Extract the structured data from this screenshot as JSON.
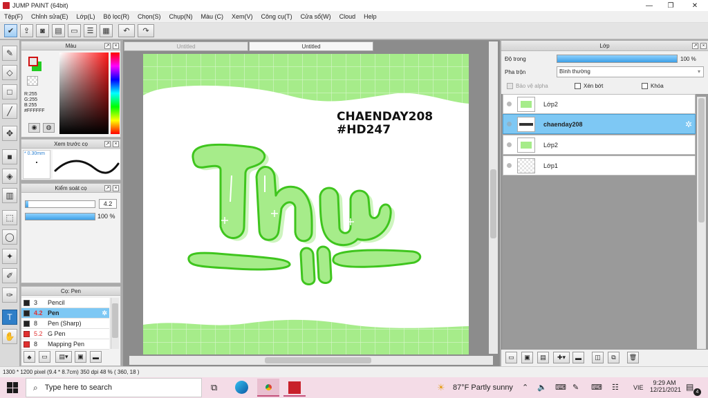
{
  "window": {
    "title": "JUMP PAINT (64bit)",
    "minimize": "—",
    "maximize": "❐",
    "close": "✕"
  },
  "menu": [
    "Tệp(F)",
    "Chỉnh sửa(E)",
    "Lớp(L)",
    "Bộ lọc(R)",
    "Chọn(S)",
    "Chụp(N)",
    "Màu (C)",
    "Xem(V)",
    "Công cụ(T)",
    "Cửa sổ(W)",
    "Cloud",
    "Help"
  ],
  "color_panel": {
    "title": "Màu",
    "r": "R:255",
    "g": "G:255",
    "b": "B:255",
    "hex": "#FFFFFF",
    "fg": "#e8e8e8",
    "bg": "#22cc22"
  },
  "brush_preview": {
    "title": "Xem trước cọ",
    "size": "0.30mm"
  },
  "brush_control": {
    "title": "Kiểm soát cọ",
    "size_value": "4.2",
    "opacity_value": "100 %",
    "size_fraction": 0.04,
    "opacity_fraction": 1.0
  },
  "brush_list": {
    "title": "Cọ: Pen",
    "items": [
      {
        "size": "3",
        "name": "Pencil",
        "color": "#222222",
        "selected": false
      },
      {
        "size": "4.2",
        "name": "Pen",
        "color": "#222222",
        "selected": true
      },
      {
        "size": "8",
        "name": "Pen (Sharp)",
        "color": "#222222",
        "selected": false
      },
      {
        "size": "5.2",
        "name": "G Pen",
        "color": "#e03030",
        "selected": false
      },
      {
        "size": "8",
        "name": "Mapping Pen",
        "color": "#e03030",
        "selected": false
      }
    ]
  },
  "doc_tabs": [
    "Untitled",
    "Untitled"
  ],
  "canvas": {
    "line1": "CHAENDAY208",
    "line2": "#HD247",
    "art": "Thu"
  },
  "layer_panel": {
    "title": "Lớp",
    "opacity_label": "Độ trong",
    "opacity_value": "100 %",
    "opacity_fraction": 1.0,
    "blend_label": "Pha trộn",
    "blend_value": "Bình thường",
    "protect_alpha": "Bảo vệ alpha",
    "clip": "Xén bớt",
    "lock": "Khóa",
    "layers": [
      {
        "name": "Lớp2",
        "selected": false
      },
      {
        "name": "chaenday208",
        "selected": true
      },
      {
        "name": "Lớp2",
        "selected": false
      },
      {
        "name": "Lớp1",
        "selected": false
      }
    ]
  },
  "status": "1300 * 1200 pixel  (9.4 * 8.7cm)  350 dpi  48 %  ( 360, 18 )",
  "taskbar": {
    "search_placeholder": "Type here to search",
    "weather": "87°F  Partly sunny",
    "lang": "VIE",
    "time": "9:29 AM",
    "date": "12/21/2021",
    "notification_count": "4"
  },
  "colors": {
    "accent": "#7ec8f4",
    "green": "#a6ec8a",
    "green_dark": "#3fc51e"
  }
}
